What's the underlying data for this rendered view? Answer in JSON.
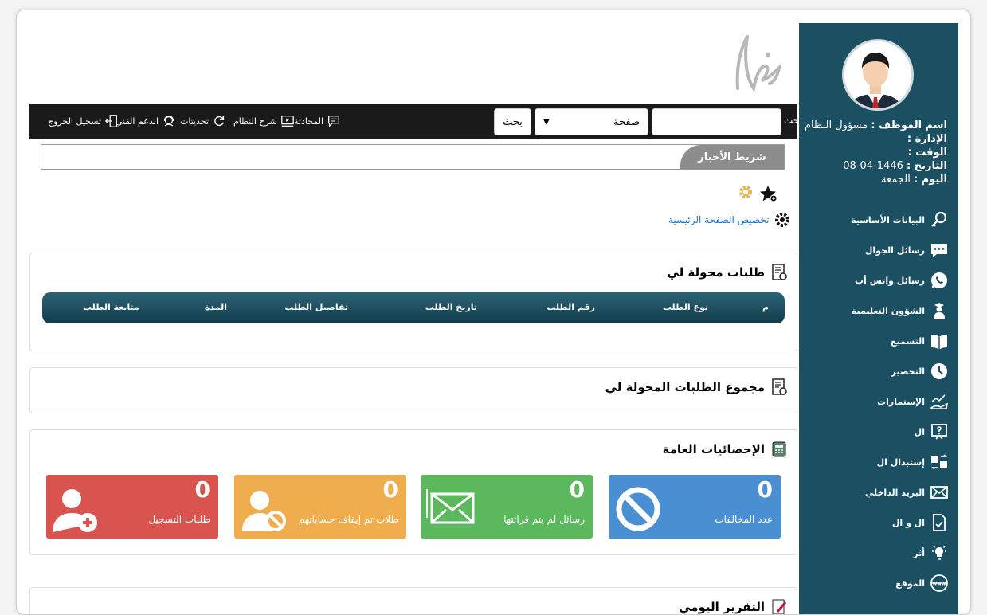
{
  "user": {
    "name_label": "اسم الموظف :",
    "name_value": "مسؤول النظام",
    "dept_label": "الإدارة :",
    "time_label": "الوقت :",
    "date_label": "التاريخ :",
    "date_value": "1446-04-08",
    "day_label": "اليوم :",
    "day_value": "الجمعة"
  },
  "sidebar": {
    "items": [
      {
        "label": "البيانات الأساسية",
        "icon": "key-search-icon"
      },
      {
        "label": "رسائل الجوال",
        "icon": "sms-icon"
      },
      {
        "label": "رسائل واتس أب",
        "icon": "whatsapp-icon"
      },
      {
        "label": "الشؤون التعليمية",
        "icon": "student-icon"
      },
      {
        "label": "التسميع",
        "icon": "book-icon"
      },
      {
        "label": "التحضير",
        "icon": "clock-icon"
      },
      {
        "label": "الإستمارات",
        "icon": "chart-hand-icon"
      },
      {
        "label": "ال",
        "icon": "question-board-icon"
      },
      {
        "label": "إستبدال ال",
        "icon": "exchange-icon"
      },
      {
        "label": "البريد الداخلي",
        "icon": "envelope-icon"
      },
      {
        "label": "ال و ال",
        "icon": "doc-check-icon"
      },
      {
        "label": "أثر",
        "icon": "bulb-icon"
      },
      {
        "label": "الموقع",
        "icon": "www-icon"
      }
    ]
  },
  "topbar": {
    "search_label": "بحث",
    "search_placeholder": "",
    "page_select": "صفحة",
    "search_button": "بحث",
    "links": {
      "chat": "المحادثة",
      "system_guide": "شرح النظام",
      "updates": "تحديثات",
      "support": "الدعم الفني",
      "logout": "تسجيل الخروج"
    }
  },
  "news": {
    "label": "شريط الأخبار"
  },
  "customize": {
    "label": "تخصيص الصفحة الرئيسية"
  },
  "panels": {
    "transferred": {
      "title": "طلبات محولة لي",
      "columns": [
        "م",
        "نوع الطلب",
        "رقم الطلب",
        "تاريخ الطلب",
        "تفاصيل الطلب",
        "المدة",
        "متابعة الطلب"
      ]
    },
    "transferred_group": {
      "title": "مجموع الطلبات المحولة لي"
    },
    "stats": {
      "title": "الإحصائيات العامة",
      "tiles": [
        {
          "value": "0",
          "label": "عدد المخالفات",
          "color": "#4a8fd2"
        },
        {
          "value": "0",
          "label": "رسائل لم يتم قرائتها",
          "color": "#5cb85c"
        },
        {
          "value": "0",
          "label": "طلاب تم إيقاف حساباتهم",
          "color": "#f0ad4e"
        },
        {
          "value": "0",
          "label": "طلبات التسجيل",
          "color": "#d9534f"
        }
      ]
    },
    "daily": {
      "title": "التقرير اليومي"
    }
  }
}
